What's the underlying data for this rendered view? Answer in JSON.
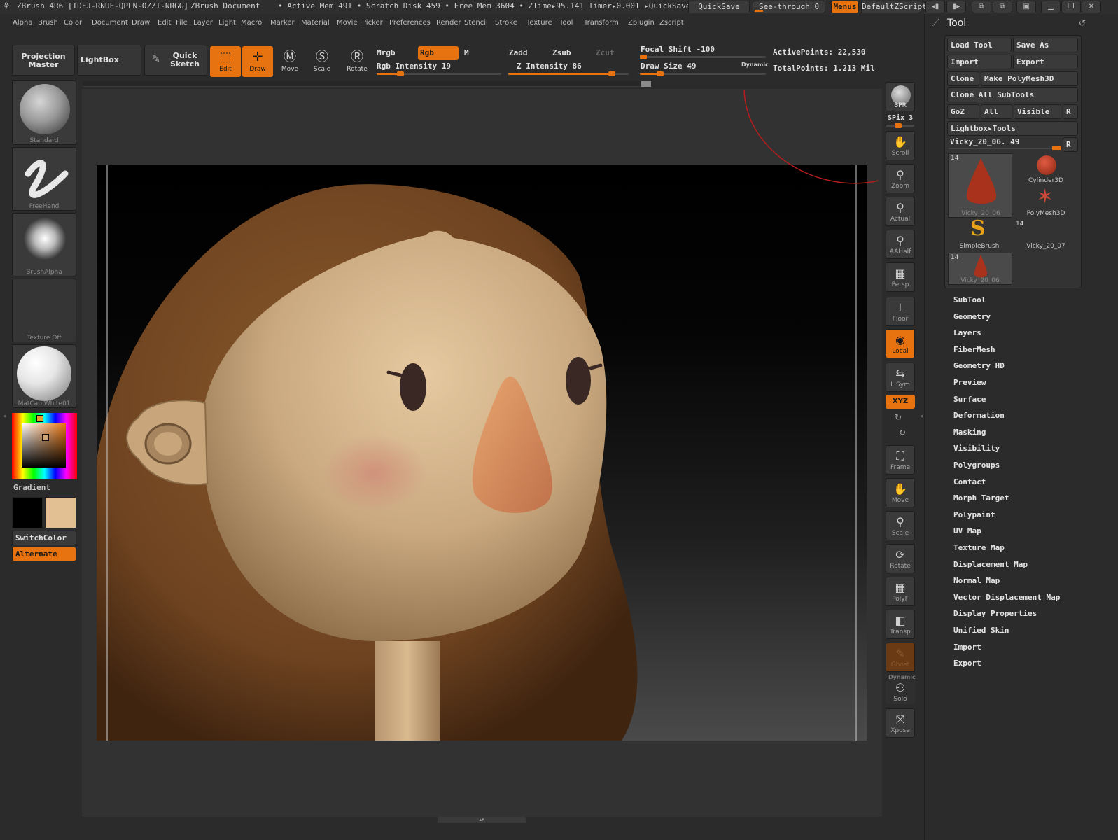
{
  "titlebar": {
    "app": "ZBrush 4R6 [TDFJ-RNUF-QPLN-OZZI-NRGG]",
    "doc": "ZBrush Document",
    "status": "• Active Mem 491 • Scratch Disk 459 • Free Mem 3604 • ZTime▸95.141  Timer▸0.001 ▸QuickSave",
    "quicksave": "QuickSave",
    "seethrough": "See-through   0",
    "menus": "Menus",
    "script": "DefaultZScript"
  },
  "menubar": [
    "Alpha",
    "Brush",
    "Color",
    "Document",
    "Draw",
    "Edit",
    "File",
    "Layer",
    "Light",
    "Macro",
    "Marker",
    "Material",
    "Movie",
    "Picker",
    "Preferences",
    "Render",
    "Stencil",
    "Stroke",
    "Texture",
    "Tool",
    "Transform",
    "Zplugin",
    "Zscript"
  ],
  "shelf": {
    "projection_master": "Projection Master",
    "lightbox": "LightBox",
    "quick_sketch": "Quick Sketch",
    "tools": [
      {
        "label": "Edit",
        "icon": "edit-icon",
        "active": true
      },
      {
        "label": "Draw",
        "icon": "draw-icon",
        "active": true
      },
      {
        "label": "Move",
        "icon": "move-icon",
        "active": false
      },
      {
        "label": "Scale",
        "icon": "scale-icon",
        "active": false
      },
      {
        "label": "Rotate",
        "icon": "rotate-icon",
        "active": false
      }
    ],
    "mrgb": "Mrgb",
    "rgb": "Rgb",
    "m": "M",
    "zadd": "Zadd",
    "zsub": "Zsub",
    "zcut": "Zcut",
    "rgb_intensity": "Rgb Intensity 19",
    "z_intensity": "Z Intensity 86",
    "focal_shift": "Focal Shift -100",
    "draw_size": "Draw Size 49",
    "dynamic": "Dynamic",
    "active_points": "ActivePoints: 22,530",
    "total_points": "TotalPoints: 1.213 Mil",
    "rgb_intensity_value": 19,
    "z_intensity_value": 86,
    "draw_size_value": 49
  },
  "left": {
    "brush": "Standard",
    "stroke": "FreeHand",
    "alpha": "BrushAlpha",
    "texture": "Texture Off",
    "material": "MatCap White01",
    "gradient": "Gradient",
    "switch_color": "SwitchColor",
    "alternate": "Alternate",
    "colors": {
      "primary": "#000000",
      "secondary": "#e3c094"
    }
  },
  "right": {
    "bpr": "BPR",
    "spix": "SPix 3",
    "buttons": [
      {
        "label": "Scroll",
        "icon": "scroll-icon"
      },
      {
        "label": "Zoom",
        "icon": "zoom-icon"
      },
      {
        "label": "Actual",
        "icon": "actual-icon"
      },
      {
        "label": "AAHalf",
        "icon": "aahalf-icon"
      },
      {
        "label": "Persp",
        "icon": "persp-icon"
      },
      {
        "label": "Floor",
        "icon": "floor-icon"
      },
      {
        "label": "Local",
        "icon": "local-icon"
      },
      {
        "label": "L.Sym",
        "icon": "lsym-icon"
      },
      {
        "label": "Frame",
        "icon": "frame-icon"
      },
      {
        "label": "Move",
        "icon": "move-icon"
      },
      {
        "label": "Scale",
        "icon": "scale-icon"
      },
      {
        "label": "Rotate",
        "icon": "rotate-icon"
      },
      {
        "label": "PolyF",
        "icon": "polyf-icon"
      },
      {
        "label": "Transp",
        "icon": "transp-icon"
      },
      {
        "label": "Ghost",
        "icon": "ghost-icon"
      },
      {
        "label": "Solo",
        "icon": "solo-icon"
      },
      {
        "label": "Xpose",
        "icon": "xpose-icon"
      }
    ],
    "xyz": "XYZ",
    "dynamic": "Dynamic"
  },
  "tool": {
    "title": "Tool",
    "load_tool": "Load Tool",
    "save_as": "Save As",
    "import": "Import",
    "export": "Export",
    "clone": "Clone",
    "make_polymesh": "Make PolyMesh3D",
    "clone_all": "Clone All SubTools",
    "goz": "GoZ",
    "all": "All",
    "visible": "Visible",
    "r": "R",
    "lightbox_tools": "Lightbox▸Tools",
    "current_tool": "Vicky_20_06. 49",
    "items": [
      {
        "label": "Vicky_20_06",
        "badge": "14"
      },
      {
        "label": "Cylinder3D",
        "badge": ""
      },
      {
        "label": "PolyMesh3D",
        "badge": ""
      },
      {
        "label": "SimpleBrush",
        "badge": ""
      },
      {
        "label": "Vicky_20_07",
        "badge": "14"
      },
      {
        "label": "Vicky_20_06",
        "badge": "14"
      }
    ],
    "sections": [
      "SubTool",
      "Geometry",
      "Layers",
      "FiberMesh",
      "Geometry HD",
      "Preview",
      "Surface",
      "Deformation",
      "Masking",
      "Visibility",
      "Polygroups",
      "Contact",
      "Morph Target",
      "Polypaint",
      "UV Map",
      "Texture Map",
      "Displacement Map",
      "Normal Map",
      "Vector Displacement Map",
      "Display Properties",
      "Unified Skin",
      "Import",
      "Export"
    ]
  }
}
